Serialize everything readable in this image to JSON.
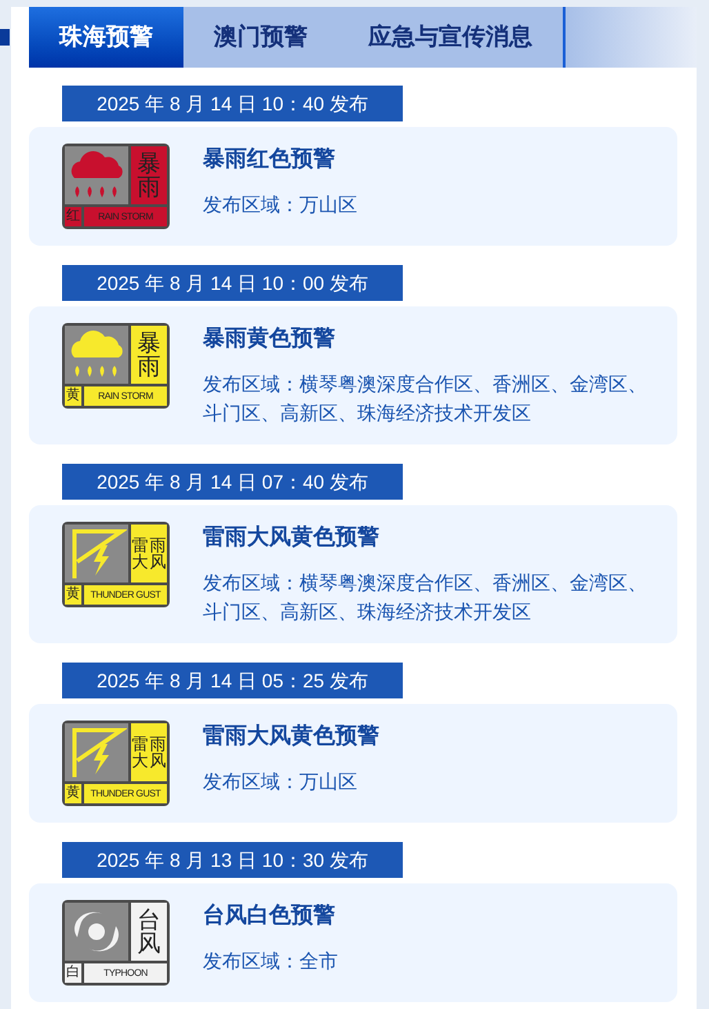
{
  "tabs": [
    {
      "label": "珠海预警",
      "selected": true
    },
    {
      "label": "澳门预警",
      "selected": false
    },
    {
      "label": "应急与宣传消息",
      "selected": false
    }
  ],
  "warnings": [
    {
      "time": "2025 年 8 月 14 日 10：40 发布",
      "title": "暴雨红色预警",
      "area": "发布区域：万山区",
      "icon": {
        "kind": "rain",
        "color": "#c8102e",
        "chars": [
          "暴",
          "雨"
        ],
        "level": "红",
        "label": "RAIN STORM"
      }
    },
    {
      "time": "2025 年 8 月 14 日 10：00 发布",
      "title": "暴雨黄色预警",
      "area": "发布区域：横琴粤澳深度合作区、香洲区、金湾区、斗门区、高新区、珠海经济技术开发区",
      "icon": {
        "kind": "rain",
        "color": "#f7e92c",
        "chars": [
          "暴",
          "雨"
        ],
        "level": "黄",
        "label": "RAIN STORM"
      }
    },
    {
      "time": "2025 年 8 月 14 日 07：40 发布",
      "title": "雷雨大风黄色预警",
      "area": "发布区域：横琴粤澳深度合作区、香洲区、金湾区、斗门区、高新区、珠海经济技术开发区",
      "icon": {
        "kind": "thunder",
        "color": "#f7e92c",
        "chars": [
          "雷",
          "雨",
          "大",
          "风"
        ],
        "level": "黄",
        "label": "THUNDER GUST"
      }
    },
    {
      "time": "2025 年 8 月 14 日 05：25 发布",
      "title": "雷雨大风黄色预警",
      "area": "发布区域：万山区",
      "icon": {
        "kind": "thunder",
        "color": "#f7e92c",
        "chars": [
          "雷",
          "雨",
          "大",
          "风"
        ],
        "level": "黄",
        "label": "THUNDER GUST"
      }
    },
    {
      "time": "2025 年 8 月 13 日 10：30 发布",
      "title": "台风白色预警",
      "area": "发布区域：全市",
      "icon": {
        "kind": "typhoon",
        "color": "#f2f2f2",
        "chars": [
          "台",
          "风"
        ],
        "level": "白",
        "label": "TYPHOON"
      }
    }
  ]
}
